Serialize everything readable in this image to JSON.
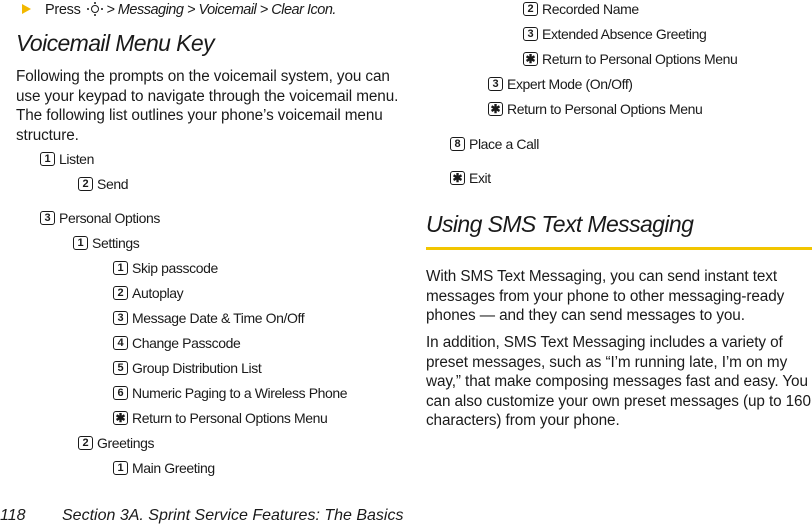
{
  "nav_instruction": {
    "prefix": "Press",
    "icon": "nav-key-icon",
    "path": "> Messaging > Voicemail > Clear Icon."
  },
  "voicemail_menu": {
    "title": "Voicemail Menu Key",
    "intro": "Following the prompts on the voicemail system, you can use your keypad to navigate through the voicemail menu. The following list outlines your phone’s voicemail menu structure.",
    "items": [
      {
        "key": "1",
        "label": "Listen",
        "level": 0
      },
      {
        "key": "2",
        "label": "Send",
        "level": 1
      },
      {
        "key": "3",
        "label": "Personal Options",
        "level": 0
      },
      {
        "key": "1",
        "label": "Settings",
        "level": 1
      },
      {
        "key": "1",
        "label": "Skip passcode",
        "level": 2
      },
      {
        "key": "2",
        "label": "Autoplay",
        "level": 2
      },
      {
        "key": "3",
        "label": "Message Date & Time On/Off",
        "level": 2
      },
      {
        "key": "4",
        "label": "Change Passcode",
        "level": 2
      },
      {
        "key": "5",
        "label": "Group Distribution List",
        "level": 2
      },
      {
        "key": "6",
        "label": "Numeric Paging to a Wireless Phone",
        "level": 2
      },
      {
        "key": "✱",
        "label": "Return to Personal Options Menu",
        "level": 2
      },
      {
        "key": "2",
        "label": "Greetings",
        "level": 1
      },
      {
        "key": "1",
        "label": "Main Greeting",
        "level": 2
      },
      {
        "key": "2",
        "label": "Recorded Name",
        "level": 2
      },
      {
        "key": "3",
        "label": "Extended Absence Greeting",
        "level": 2
      },
      {
        "key": "✱",
        "label": "Return to Personal Options Menu",
        "level": 2
      },
      {
        "key": "3",
        "label": "Expert Mode (On/Off)",
        "level": 1
      },
      {
        "key": "✱",
        "label": "Return to Personal Options Menu",
        "level": 1
      },
      {
        "key": "8",
        "label": "Place a Call",
        "level": 0
      },
      {
        "key": "✱",
        "label": "Exit",
        "level": 0
      }
    ]
  },
  "sms_section": {
    "title": "Using SMS Text Messaging",
    "paragraphs": [
      "With SMS Text Messaging, you can send instant text messages from your phone to other messaging-ready phones — and they can send messages to you.",
      "In addition, SMS Text Messaging includes a variety of preset messages, such as “I’m running late, I’m on my way,” that make composing messages fast and easy. You can also customize your own preset messages (up to 160 characters) from your phone."
    ],
    "accent_color": "#f2c500"
  },
  "footer": {
    "page_number": "118",
    "section": "Section 3A. Sprint Service Features: The Basics"
  }
}
